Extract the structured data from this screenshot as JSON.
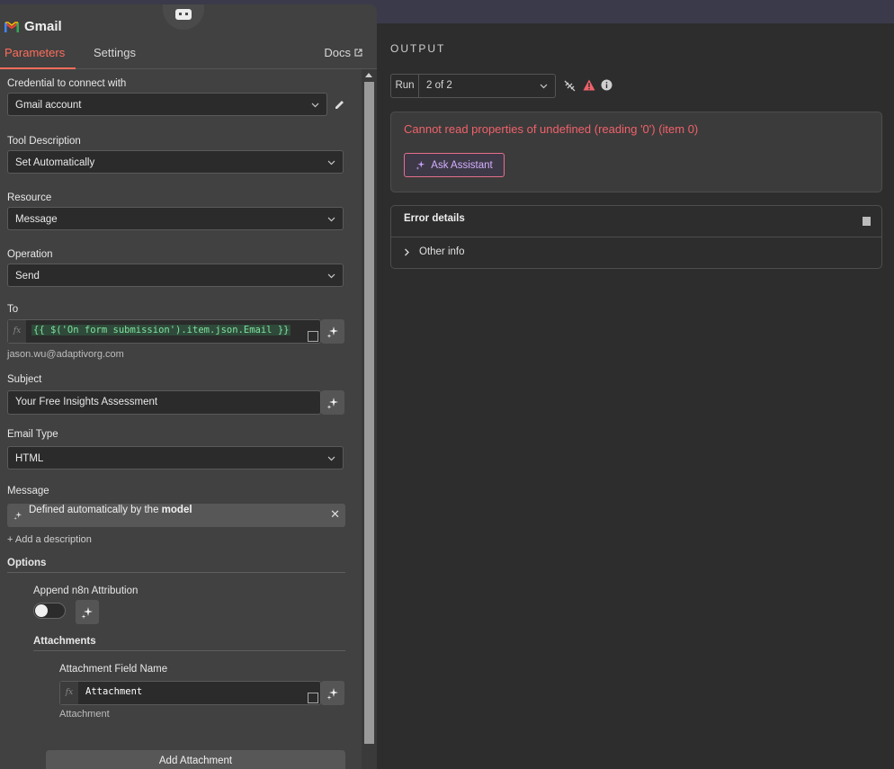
{
  "node": {
    "title": "Gmail",
    "tabs": [
      "Parameters",
      "Settings"
    ],
    "docs_label": "Docs"
  },
  "form": {
    "credential": {
      "label": "Credential to connect with",
      "value": "Gmail account"
    },
    "tool_description": {
      "label": "Tool Description",
      "value": "Set Automatically"
    },
    "resource": {
      "label": "Resource",
      "value": "Message"
    },
    "operation": {
      "label": "Operation",
      "value": "Send"
    },
    "to": {
      "label": "To",
      "expression": "{{ $('On form submission').item.json.Email }}",
      "resolved": "jason.wu@adaptivorg.com"
    },
    "subject": {
      "label": "Subject",
      "value": "Your Free Insights Assessment"
    },
    "email_type": {
      "label": "Email Type",
      "value": "HTML"
    },
    "message": {
      "label": "Message",
      "text_prefix": "Defined automatically by the ",
      "text_bold": "model"
    },
    "add_description": "+ Add a description",
    "options_label": "Options",
    "append_attribution": {
      "label": "Append n8n Attribution",
      "enabled": false
    },
    "attachments_label": "Attachments",
    "attachment_field": {
      "label": "Attachment Field Name",
      "value": "Attachment",
      "resolved": "Attachment"
    },
    "add_attachment": "Add Attachment"
  },
  "output": {
    "title": "OUTPUT",
    "run_label": "Run",
    "run_value": "2 of 2",
    "error_message": "Cannot read properties of undefined (reading '0') (item 0)",
    "ask_assistant": "Ask Assistant",
    "error_details": "Error details",
    "other_info": "Other info"
  },
  "colors": {
    "accent": "#ff6d5a",
    "error": "#f0626a",
    "expression": "#7fe39f"
  }
}
